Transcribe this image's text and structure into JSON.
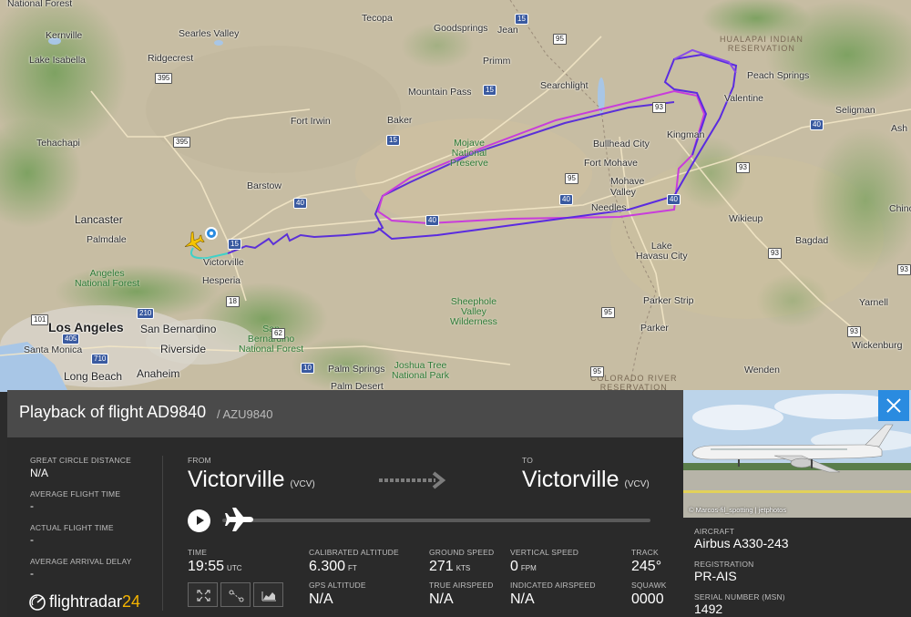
{
  "map": {
    "labels": {
      "national_forest_top": "National Forest",
      "kernville": "Kernville",
      "lake_isabella": "Lake Isabella",
      "searles_valley": "Searles Valley",
      "ridgecrest": "Ridgecrest",
      "tehachapi": "Tehachapi",
      "fort_irwin": "Fort Irwin",
      "barstow": "Barstow",
      "lancaster": "Lancaster",
      "palmdale": "Palmdale",
      "victorville": "Victorville",
      "hesperia": "Hesperia",
      "angeles_nf": "Angeles\nNational Forest",
      "los_angeles": "Los Angeles",
      "santa_monica": "Santa Monica",
      "long_beach": "Long Beach",
      "anaheim": "Anaheim",
      "san_bernardino": "San Bernardino",
      "riverside": "Riverside",
      "sb_nf": "San\nBernardino\nNational Forest",
      "palm_springs": "Palm Springs",
      "palm_desert": "Palm Desert",
      "joshua_tree": "Joshua Tree\nNational Park",
      "tecopa": "Tecopa",
      "goodsprings": "Goodsprings",
      "jean": "Jean",
      "primm": "Primm",
      "mountain_pass": "Mountain Pass",
      "baker": "Baker",
      "searchlight": "Searchlight",
      "mojave": "Mojave\nNational\nPreserve",
      "bullhead": "Bullhead City",
      "fort_mohave": "Fort Mohave",
      "mohave_valley": "Mohave\nValley",
      "needles": "Needles",
      "kingman": "Kingman",
      "valentine": "Valentine",
      "peach_springs": "Peach Springs",
      "seligman": "Seligman",
      "ash": "Ash",
      "hualapai": "HUALAPAI INDIAN\nRESERVATION",
      "wikieup": "Wikieup",
      "bagdad": "Bagdad",
      "chino": "Chino",
      "lake_havasu": "Lake\nHavasu City",
      "parker_strip": "Parker Strip",
      "parker": "Parker",
      "sheephole": "Sheephole\nValley\nWilderness",
      "colorado_river": "COLORADO RIVER\nRESERVATION",
      "yarnell": "Yarnell",
      "wickenburg": "Wickenburg",
      "wenden": "Wenden"
    },
    "highways": [
      "395",
      "395",
      "15",
      "15",
      "40",
      "40",
      "40",
      "40",
      "40",
      "93",
      "93",
      "93",
      "95",
      "95",
      "95",
      "93",
      "93",
      "95",
      "10",
      "210",
      "710",
      "405",
      "101",
      "15",
      "62",
      "18",
      "15"
    ]
  },
  "header": {
    "title": "Playback of flight AD9840",
    "subtitle": "/ AZU9840"
  },
  "stats": {
    "great_circle_label": "GREAT CIRCLE DISTANCE",
    "great_circle_value": "N/A",
    "avg_flight_label": "AVERAGE FLIGHT TIME",
    "avg_flight_value": "-",
    "actual_flight_label": "ACTUAL FLIGHT TIME",
    "actual_flight_value": "-",
    "avg_delay_label": "AVERAGE ARRIVAL DELAY",
    "avg_delay_value": "-"
  },
  "route": {
    "from_label": "FROM",
    "from_city": "Victorville",
    "from_code": "(VCV)",
    "to_label": "TO",
    "to_city": "Victorville",
    "to_code": "(VCV)"
  },
  "telemetry": {
    "time_label": "TIME",
    "time_value": "19:55",
    "time_unit": "UTC",
    "cal_alt_label": "CALIBRATED ALTITUDE",
    "cal_alt_value": "6.300",
    "cal_alt_unit": "FT",
    "gps_alt_label": "GPS ALTITUDE",
    "gps_alt_value": "N/A",
    "ground_speed_label": "GROUND SPEED",
    "ground_speed_value": "271",
    "ground_speed_unit": "KTS",
    "true_airspeed_label": "TRUE AIRSPEED",
    "true_airspeed_value": "N/A",
    "vertical_speed_label": "VERTICAL SPEED",
    "vertical_speed_value": "0",
    "vertical_speed_unit": "FPM",
    "indicated_airspeed_label": "INDICATED AIRSPEED",
    "indicated_airspeed_value": "N/A",
    "track_label": "TRACK",
    "track_value": "245°",
    "squawk_label": "SQUAWK",
    "squawk_value": "0000"
  },
  "branding": {
    "logo_text": "flightradar",
    "logo_number": "24"
  },
  "aircraft": {
    "photo_credit": "© Marcos-fil_spotting | jetphotos",
    "aircraft_label": "AIRCRAFT",
    "aircraft_value": "Airbus A330-243",
    "registration_label": "REGISTRATION",
    "registration_value": "PR-AIS",
    "serial_label": "SERIAL NUMBER (MSN)",
    "serial_value": "1492"
  },
  "colors": {
    "accent_blue": "#2a8be0",
    "track_purple": "#6a2bd6",
    "track_magenta": "#d43ad9",
    "track_teal": "#3fd1c8",
    "plane_yellow": "#f5c400",
    "logo_yellow": "#f5b400"
  }
}
